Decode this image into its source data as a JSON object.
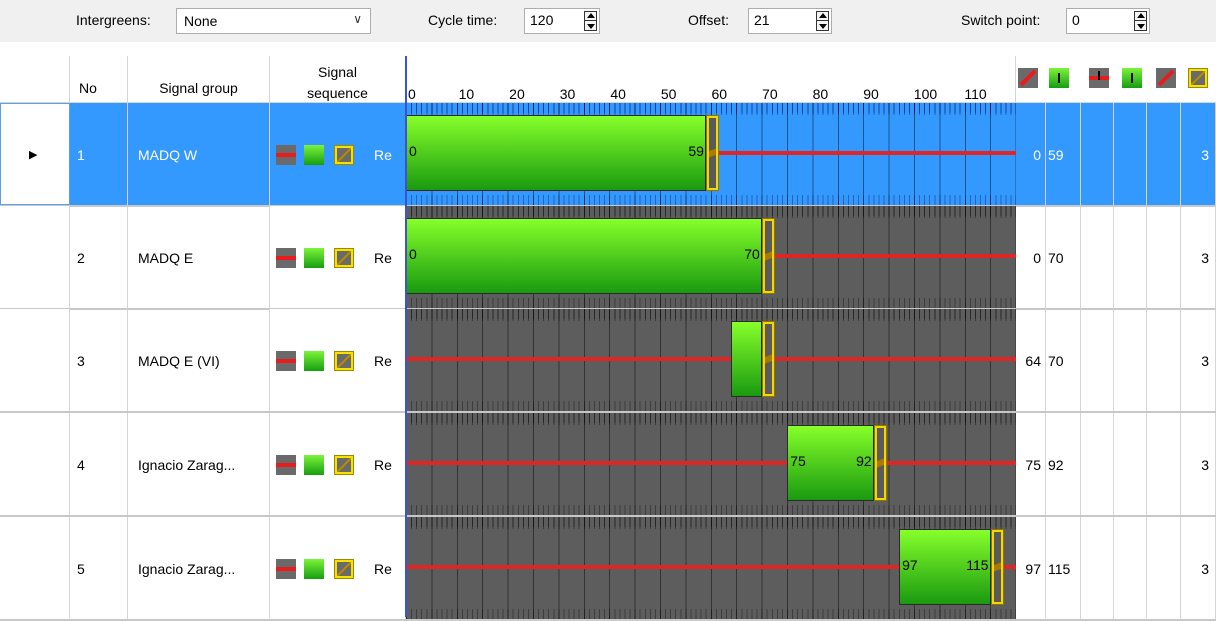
{
  "toolbar": {
    "intergreens_label": "Intergreens:",
    "intergreens_value": "None",
    "cycle_time_label": "Cycle time:",
    "cycle_time_value": "120",
    "offset_label": "Offset:",
    "offset_value": "21",
    "switch_point_label": "Switch point:",
    "switch_point_value": "0"
  },
  "columns": {
    "no": "No",
    "signal_group": "Signal group",
    "signal_sequence_line1": "Signal",
    "signal_sequence_line2": "sequence"
  },
  "axis_ticks": [
    "0",
    "10",
    "20",
    "30",
    "40",
    "50",
    "60",
    "70",
    "80",
    "90",
    "100",
    "110"
  ],
  "extra_columns_icons": [
    "red-light-icon",
    "green-arrow-icon",
    "red-arrow-icon",
    "green-down-icon",
    "red-x-icon",
    "amber-icon"
  ],
  "rows": [
    {
      "no": "1",
      "name": "MADQ W",
      "seq_text": "Re",
      "green_start": 0,
      "green_end": 59,
      "start_label": "0",
      "end_label": "59",
      "col_start": "0",
      "col_end": "59",
      "last": "3",
      "selected": true
    },
    {
      "no": "2",
      "name": "MADQ E",
      "seq_text": "Re",
      "green_start": 0,
      "green_end": 70,
      "start_label": "0",
      "end_label": "70",
      "col_start": "0",
      "col_end": "70",
      "last": "3",
      "selected": false
    },
    {
      "no": "3",
      "name": "MADQ E (VI)",
      "seq_text": "Re",
      "green_start": 64,
      "green_end": 70,
      "start_label": "",
      "end_label": "",
      "col_start": "64",
      "col_end": "70",
      "last": "3",
      "selected": false
    },
    {
      "no": "4",
      "name": "Ignacio Zarag...",
      "seq_text": "Re",
      "green_start": 75,
      "green_end": 92,
      "start_label": "75",
      "end_label": "92",
      "col_start": "75",
      "col_end": "92",
      "last": "3",
      "selected": false
    },
    {
      "no": "5",
      "name": "Ignacio Zarag...",
      "seq_text": "Re",
      "green_start": 97,
      "green_end": 115,
      "start_label": "97",
      "end_label": "115",
      "col_start": "97",
      "col_end": "115",
      "last": "3",
      "selected": false
    }
  ],
  "cycle_length": 120,
  "colors": {
    "selection": "#3399ff",
    "green": "#3ad61a",
    "red": "#e02525",
    "amber": "#f6d800",
    "timeline_bg": "#5d5d5d"
  }
}
